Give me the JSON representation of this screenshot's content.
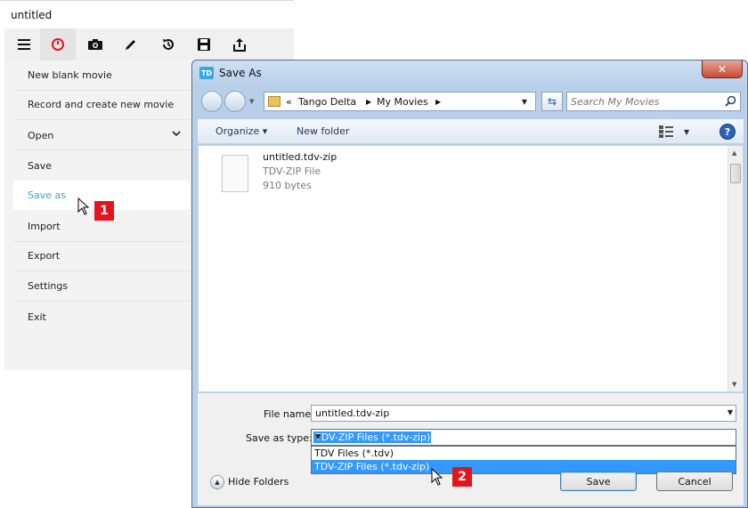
{
  "app": {
    "title": "untitled",
    "toolbar": [
      "menu-icon",
      "record-icon",
      "camera-icon",
      "pencil-icon",
      "history-icon",
      "save-icon",
      "share-icon"
    ],
    "menu": [
      {
        "label": "New blank movie"
      },
      {
        "label": "Record and create new movie"
      },
      {
        "label": "Open"
      },
      {
        "label": "Save"
      },
      {
        "label": "Save as"
      },
      {
        "label": "Import"
      },
      {
        "label": "Export"
      },
      {
        "label": "Settings"
      },
      {
        "label": "Exit"
      }
    ]
  },
  "callouts": {
    "first": "1",
    "second": "2"
  },
  "dialog": {
    "title": "Save As",
    "close_label": "✕",
    "breadcrumb": {
      "prefix": "«",
      "parts": [
        "Tango Delta",
        "My Movies"
      ]
    },
    "search_placeholder": "Search My Movies",
    "commands": {
      "organize": "Organize ▾",
      "new_folder": "New folder"
    },
    "file": {
      "name": "untitled.tdv-zip",
      "type": "TDV-ZIP File",
      "size": "910 bytes"
    },
    "file_name_label": "File name:",
    "file_name_value": "untitled.tdv-zip",
    "save_type_label": "Save as type:",
    "save_type_value": "TDV-ZIP Files (*.tdv-zip)",
    "save_type_options": [
      "TDV Files (*.tdv)",
      "TDV-ZIP Files (*.tdv-zip)"
    ],
    "hide_folders": "Hide Folders",
    "save_button": "Save",
    "cancel_button": "Cancel"
  },
  "colors": {
    "accent": "#34a1de",
    "callout": "#e3141c",
    "selection": "#3399ff"
  }
}
